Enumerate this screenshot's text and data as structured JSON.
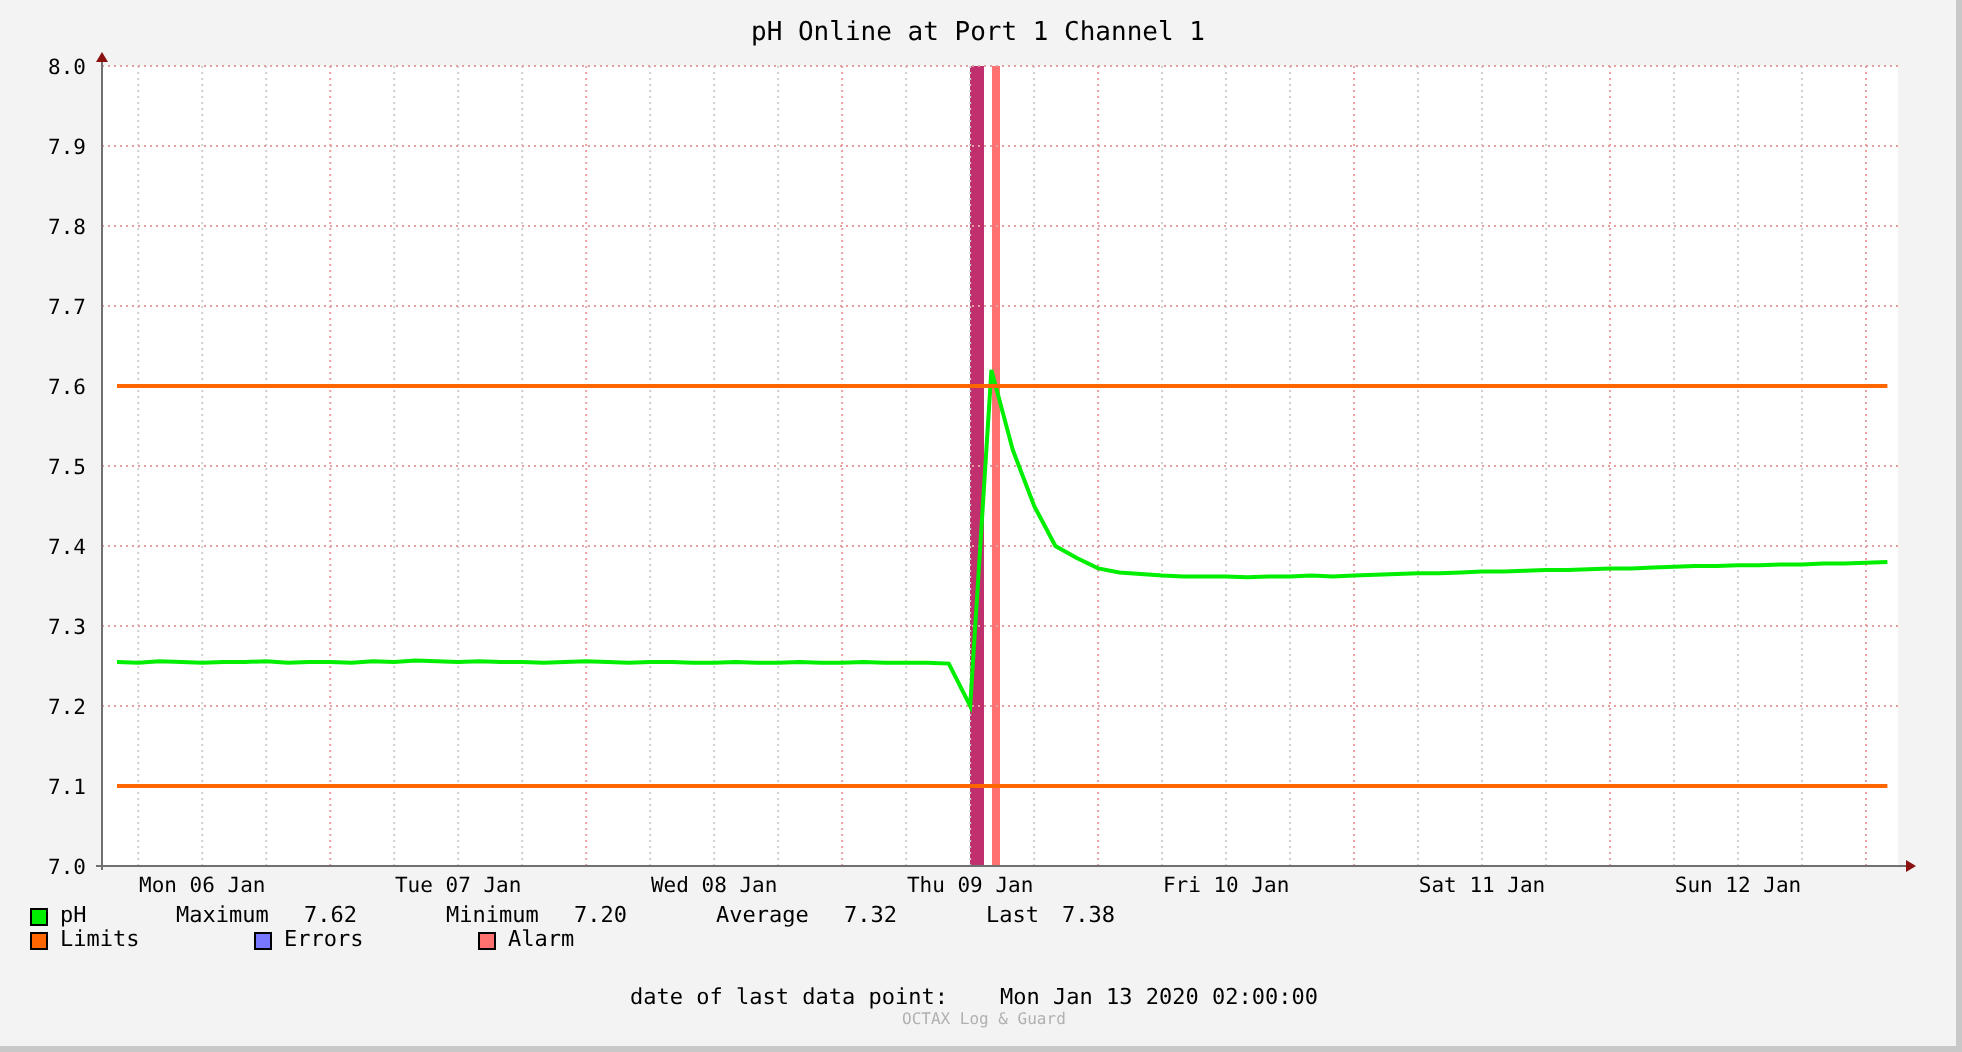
{
  "title": "pH Online at Port 1 Channel 1",
  "chart": {
    "chart_data": {
      "type": "line",
      "ylim": [
        7.0,
        8.0
      ],
      "grid": true,
      "yticks": [
        {
          "value": 7.0,
          "label": "7.0"
        },
        {
          "value": 7.1,
          "label": "7.1"
        },
        {
          "value": 7.2,
          "label": "7.2"
        },
        {
          "value": 7.3,
          "label": "7.3"
        },
        {
          "value": 7.4,
          "label": "7.4"
        },
        {
          "value": 7.5,
          "label": "7.5"
        },
        {
          "value": 7.6,
          "label": "7.6"
        },
        {
          "value": 7.7,
          "label": "7.7"
        },
        {
          "value": 7.8,
          "label": "7.8"
        },
        {
          "value": 7.9,
          "label": "7.9"
        },
        {
          "value": 8.0,
          "label": "8.0"
        }
      ],
      "categories": [
        null,
        null,
        null,
        null,
        "Mon 06 Jan",
        null,
        null,
        null,
        null,
        null,
        null,
        null,
        null,
        null,
        null,
        null,
        "Tue 07 Jan",
        null,
        null,
        null,
        null,
        null,
        null,
        null,
        null,
        null,
        null,
        null,
        "Wed 08 Jan",
        null,
        null,
        null,
        null,
        null,
        null,
        null,
        null,
        null,
        null,
        null,
        "Thu 09 Jan",
        null,
        null,
        null,
        null,
        null,
        null,
        null,
        null,
        null,
        null,
        null,
        "Fri 10 Jan",
        null,
        null,
        null,
        null,
        null,
        null,
        null,
        null,
        null,
        null,
        null,
        "Sat 11 Jan",
        null,
        null,
        null,
        null,
        null,
        null,
        null,
        null,
        null,
        null,
        null,
        "Sun 12 Jan",
        null,
        null,
        null,
        null,
        null,
        null,
        null
      ],
      "series": [
        {
          "name": "pH",
          "color": "#00ee00",
          "values": [
            7.255,
            7.254,
            7.256,
            7.255,
            7.254,
            7.255,
            7.255,
            7.256,
            7.254,
            7.255,
            7.255,
            7.254,
            7.256,
            7.255,
            7.257,
            7.256,
            7.255,
            7.256,
            7.255,
            7.255,
            7.254,
            7.255,
            7.256,
            7.255,
            7.254,
            7.255,
            7.255,
            7.254,
            7.254,
            7.255,
            7.254,
            7.254,
            7.255,
            7.254,
            7.254,
            7.255,
            7.254,
            7.254,
            7.254,
            7.253,
            7.2,
            7.62,
            7.52,
            7.45,
            7.4,
            7.385,
            7.372,
            7.367,
            7.365,
            7.363,
            7.362,
            7.362,
            7.362,
            7.361,
            7.362,
            7.362,
            7.363,
            7.362,
            7.363,
            7.364,
            7.365,
            7.366,
            7.366,
            7.367,
            7.368,
            7.368,
            7.369,
            7.37,
            7.37,
            7.371,
            7.372,
            7.372,
            7.373,
            7.374,
            7.375,
            7.375,
            7.376,
            7.376,
            7.377,
            7.377,
            7.378,
            7.378,
            7.379,
            7.38
          ]
        },
        {
          "name": "Limits",
          "color": "#ff6600",
          "values": [
            7.6,
            7.6,
            7.6,
            7.6,
            7.6,
            7.6,
            7.6,
            7.6,
            7.6,
            7.6,
            7.6,
            7.6,
            7.6,
            7.6,
            7.6,
            7.6,
            7.6,
            7.6,
            7.6,
            7.6,
            7.6,
            7.6,
            7.6,
            7.6,
            7.6,
            7.6,
            7.6,
            7.6,
            7.6,
            7.6,
            7.6,
            7.6,
            7.6,
            7.6,
            7.6,
            7.6,
            7.6,
            7.6,
            7.6,
            7.6,
            7.6,
            7.6,
            7.6,
            7.6,
            7.6,
            7.6,
            7.6,
            7.6,
            7.6,
            7.6,
            7.6,
            7.6,
            7.6,
            7.6,
            7.6,
            7.6,
            7.6,
            7.6,
            7.6,
            7.6,
            7.6,
            7.6,
            7.6,
            7.6,
            7.6,
            7.6,
            7.6,
            7.6,
            7.6,
            7.6,
            7.6,
            7.6,
            7.6,
            7.6,
            7.6,
            7.6,
            7.6,
            7.6,
            7.6,
            7.6,
            7.6,
            7.6,
            7.6,
            7.6
          ]
        },
        {
          "color": "#ff6600",
          "values": [
            7.1,
            7.1,
            7.1,
            7.1,
            7.1,
            7.1,
            7.1,
            7.1,
            7.1,
            7.1,
            7.1,
            7.1,
            7.1,
            7.1,
            7.1,
            7.1,
            7.1,
            7.1,
            7.1,
            7.1,
            7.1,
            7.1,
            7.1,
            7.1,
            7.1,
            7.1,
            7.1,
            7.1,
            7.1,
            7.1,
            7.1,
            7.1,
            7.1,
            7.1,
            7.1,
            7.1,
            7.1,
            7.1,
            7.1,
            7.1,
            7.1,
            7.1,
            7.1,
            7.1,
            7.1,
            7.1,
            7.1,
            7.1,
            7.1,
            7.1,
            7.1,
            7.1,
            7.1,
            7.1,
            7.1,
            7.1,
            7.1,
            7.1,
            7.1,
            7.1,
            7.1,
            7.1,
            7.1,
            7.1,
            7.1,
            7.1,
            7.1,
            7.1,
            7.1,
            7.1,
            7.1,
            7.1,
            7.1,
            7.1,
            7.1,
            7.1,
            7.1,
            7.1,
            7.1,
            7.1,
            7.1,
            7.1,
            7.1,
            7.1
          ]
        }
      ]
    }
  },
  "legend": [
    {
      "stats": [
        {
          "label": "Maximum",
          "value": "7.62"
        },
        {
          "label": "Minimum",
          "value": "7.20"
        },
        {
          "label": "Average",
          "value": "7.32"
        },
        {
          "label": "Last",
          "value": "7.38"
        }
      ]
    },
    {
      "label": "Errors",
      "color": "#7777ff"
    },
    {
      "label": "Alarm",
      "color": "#ff7070"
    }
  ],
  "footer": {
    "label": "date of last data point:",
    "value": "Mon Jan 13 2020 02:00:00"
  },
  "credit": "OCTAX Log & Guard"
}
